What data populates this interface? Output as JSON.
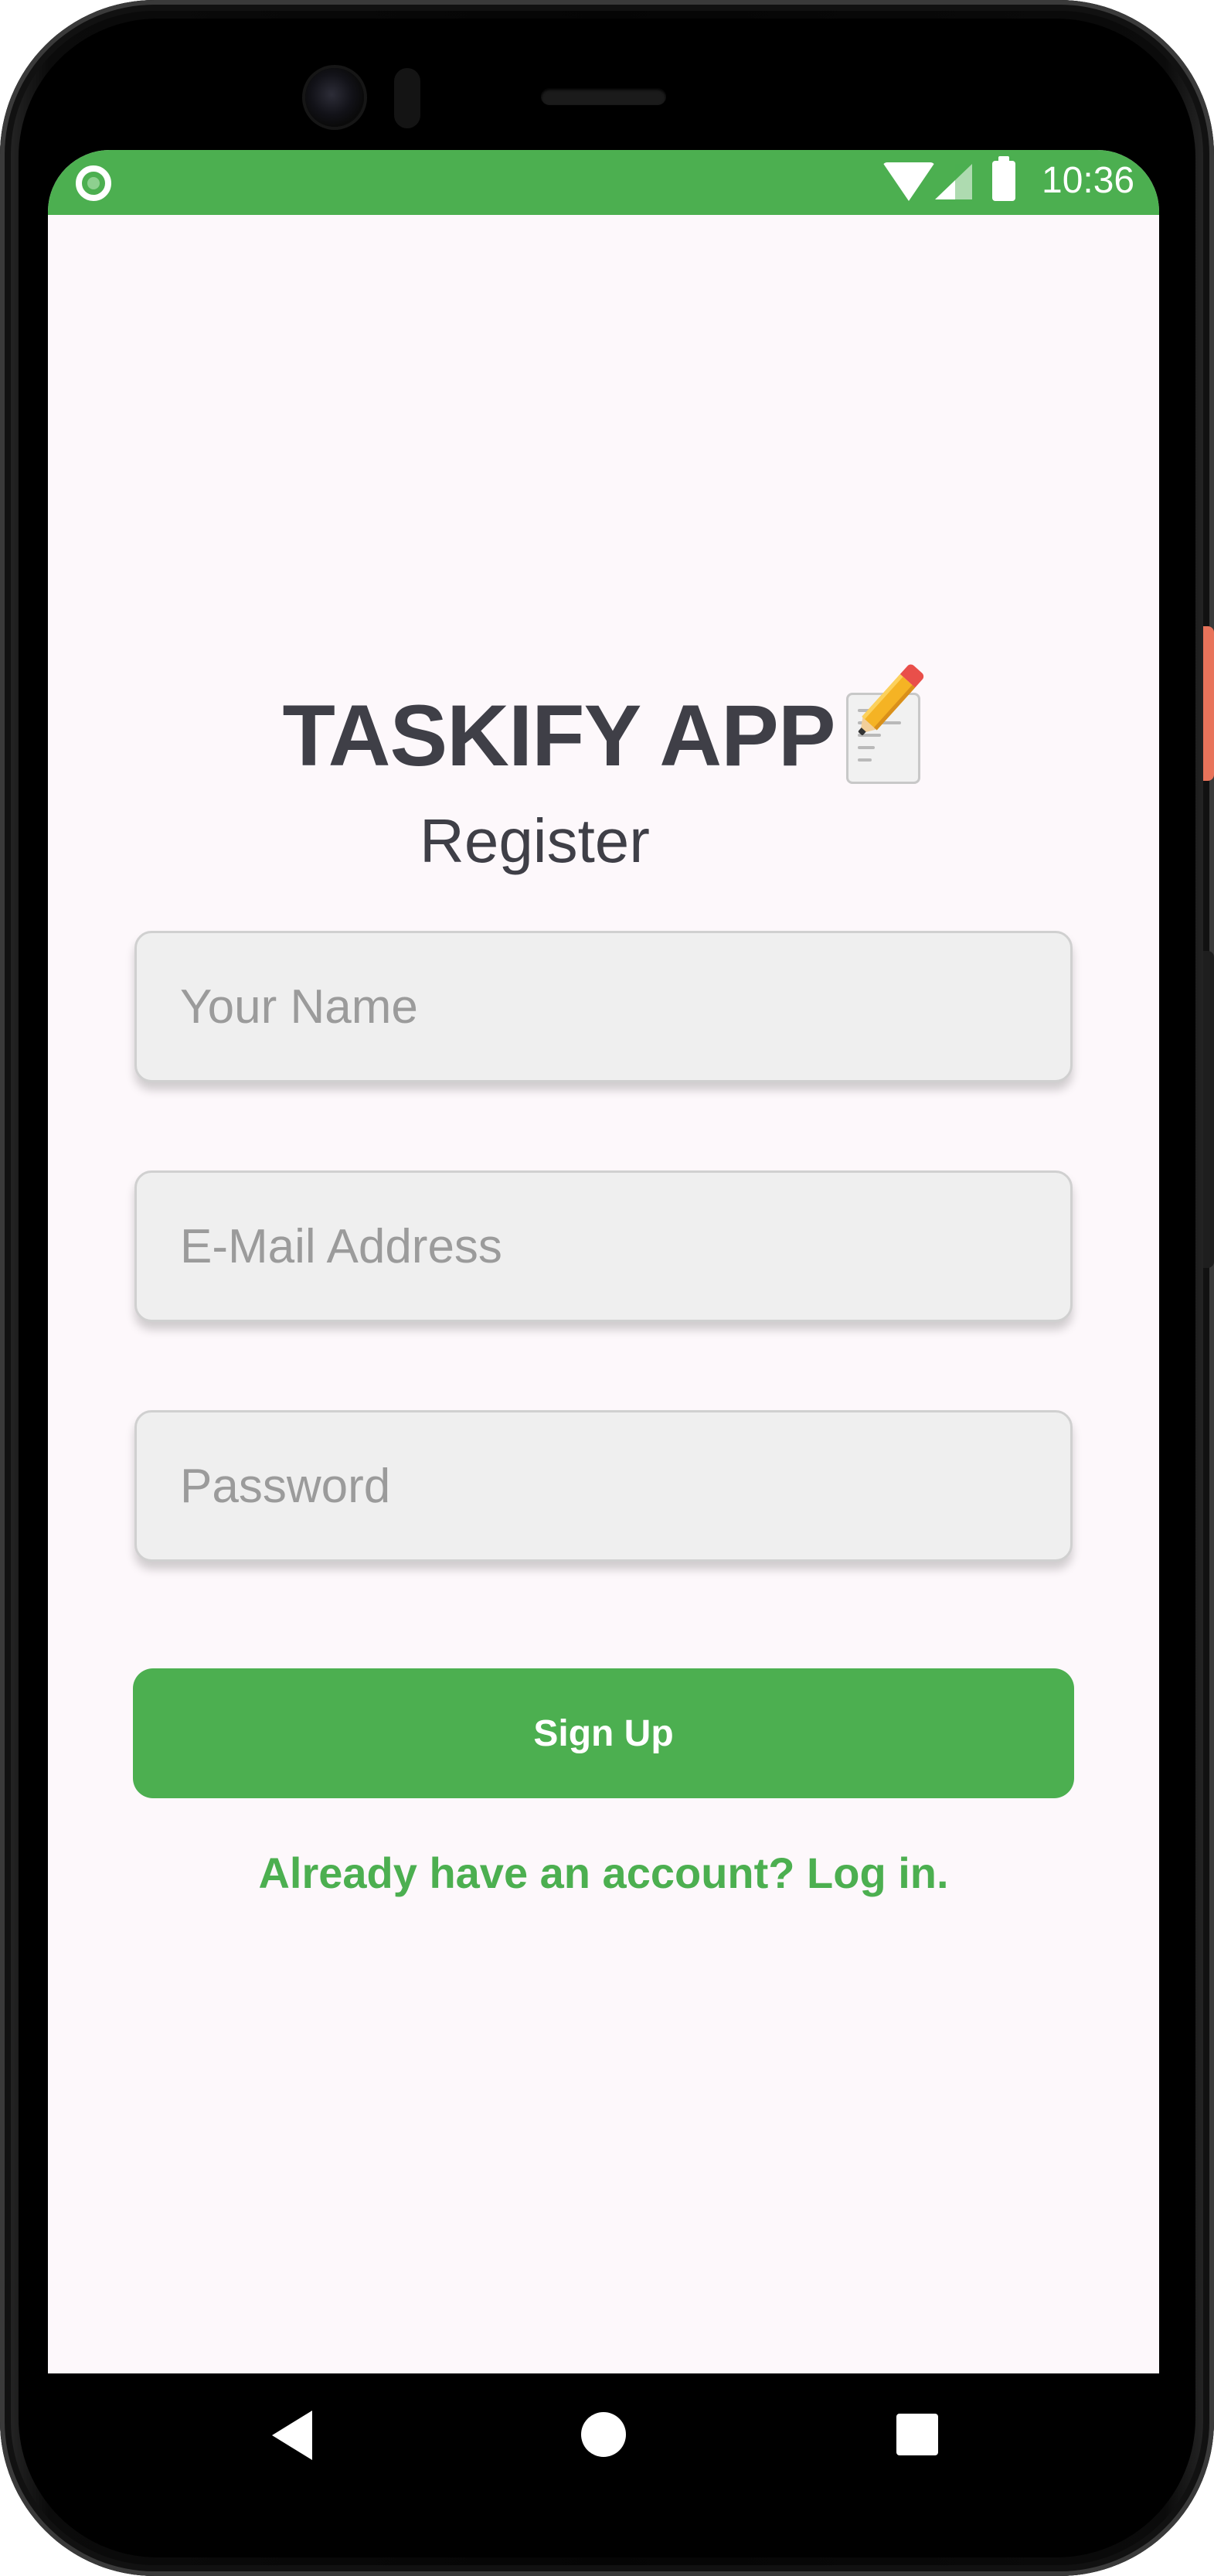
{
  "status_bar": {
    "time": "10:36",
    "icons": [
      "status-indicator-icon",
      "wifi-icon",
      "signal-icon",
      "battery-icon"
    ],
    "color": "#4caf50"
  },
  "header": {
    "app_title": "TASKIFY APP",
    "title_icon": "memo-pencil-icon",
    "subtitle": "Register"
  },
  "form": {
    "name_placeholder": "Your Name",
    "email_placeholder": "E-Mail Address",
    "password_placeholder": "Password",
    "submit_label": "Sign Up",
    "login_link_label": "Already have an account? Log in."
  },
  "navigation": {
    "icons": [
      "back-icon",
      "home-icon",
      "recents-icon"
    ]
  },
  "colors": {
    "accent": "#4caf50",
    "title_text": "#3f3f47",
    "background": "#fdf8fb",
    "field_background": "#efefef"
  }
}
